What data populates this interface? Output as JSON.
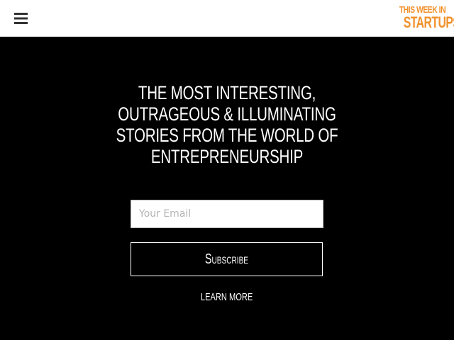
{
  "header": {
    "menu_icon": "hamburger-menu-icon",
    "logo": {
      "line1": "THIS WEEK IN",
      "line2": "STARTUPS",
      "color": "#f0912b"
    },
    "background": "#ffffff"
  },
  "hero": {
    "headline": "THE MOST INTERESTING, OUTRAGEOUS & ILLUMINATING STORIES FROM THE WORLD OF ENTREPRENEURSHIP",
    "email_placeholder": "Your Email",
    "email_value": "",
    "subscribe_label": "Subscribe",
    "learn_more_label": "LEARN MORE",
    "background": "#000000"
  }
}
